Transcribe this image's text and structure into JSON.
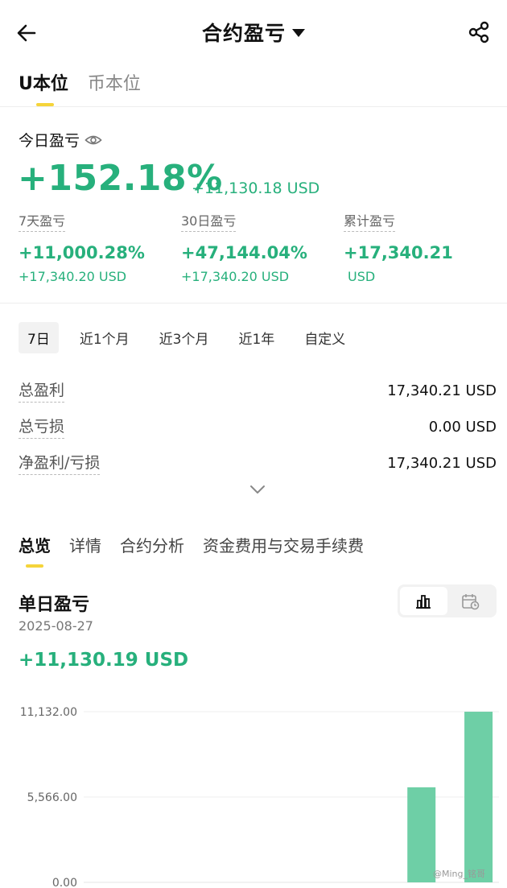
{
  "header": {
    "title": "合约盈亏",
    "back_icon": "arrow-left-icon",
    "share_icon": "share-icon"
  },
  "unit_tabs": [
    {
      "label": "U本位",
      "active": true
    },
    {
      "label": "币本位",
      "active": false
    }
  ],
  "today": {
    "label": "今日盈亏",
    "pct": "+152.18%",
    "usd": "+11,130.18 USD",
    "icon": "eye-icon"
  },
  "stats": [
    {
      "label": "7天盈亏",
      "pct": "+11,000.28%",
      "usd": "+17,340.20 USD"
    },
    {
      "label": "30日盈亏",
      "pct": "+47,144.04%",
      "usd": "+17,340.20 USD"
    },
    {
      "label": "累计盈亏",
      "pct": "+17,340.21",
      "usd": "USD"
    }
  ],
  "range_tabs": [
    {
      "label": "7日",
      "active": true
    },
    {
      "label": "近1个月",
      "active": false
    },
    {
      "label": "近3个月",
      "active": false
    },
    {
      "label": "近1年",
      "active": false
    },
    {
      "label": "自定义",
      "active": false
    }
  ],
  "summary": [
    {
      "label": "总盈利",
      "value": "17,340.21 USD"
    },
    {
      "label": "总亏损",
      "value": "0.00 USD"
    },
    {
      "label": "净盈利/亏损",
      "value": "17,340.21 USD"
    }
  ],
  "section_tabs": [
    {
      "label": "总览",
      "active": true
    },
    {
      "label": "详情",
      "active": false
    },
    {
      "label": "合约分析",
      "active": false
    },
    {
      "label": "资金费用与交易手续费",
      "active": false
    }
  ],
  "daily": {
    "title": "单日盈亏",
    "date": "2025-08-27",
    "value": "+11,130.19 USD"
  },
  "view_toggle": {
    "active": "bar-chart-icon",
    "options": [
      "bar-chart-icon",
      "calendar-icon"
    ]
  },
  "colors": {
    "positive": "#27b07c",
    "bar": "#6ecfa6",
    "accent": "#f5d43a"
  },
  "chart_data": {
    "type": "bar",
    "categories": [
      "",
      "",
      "",
      "",
      "",
      "",
      ""
    ],
    "values": [
      0,
      0,
      0,
      0,
      0,
      6200,
      11130.19
    ],
    "ylim": [
      0,
      11132
    ],
    "yticks": [
      0,
      5566,
      11132
    ],
    "ytick_labels": [
      "0.00",
      "5,566.00",
      "11,132.00"
    ],
    "grid": true
  },
  "watermark": "@Ming_铭哥"
}
